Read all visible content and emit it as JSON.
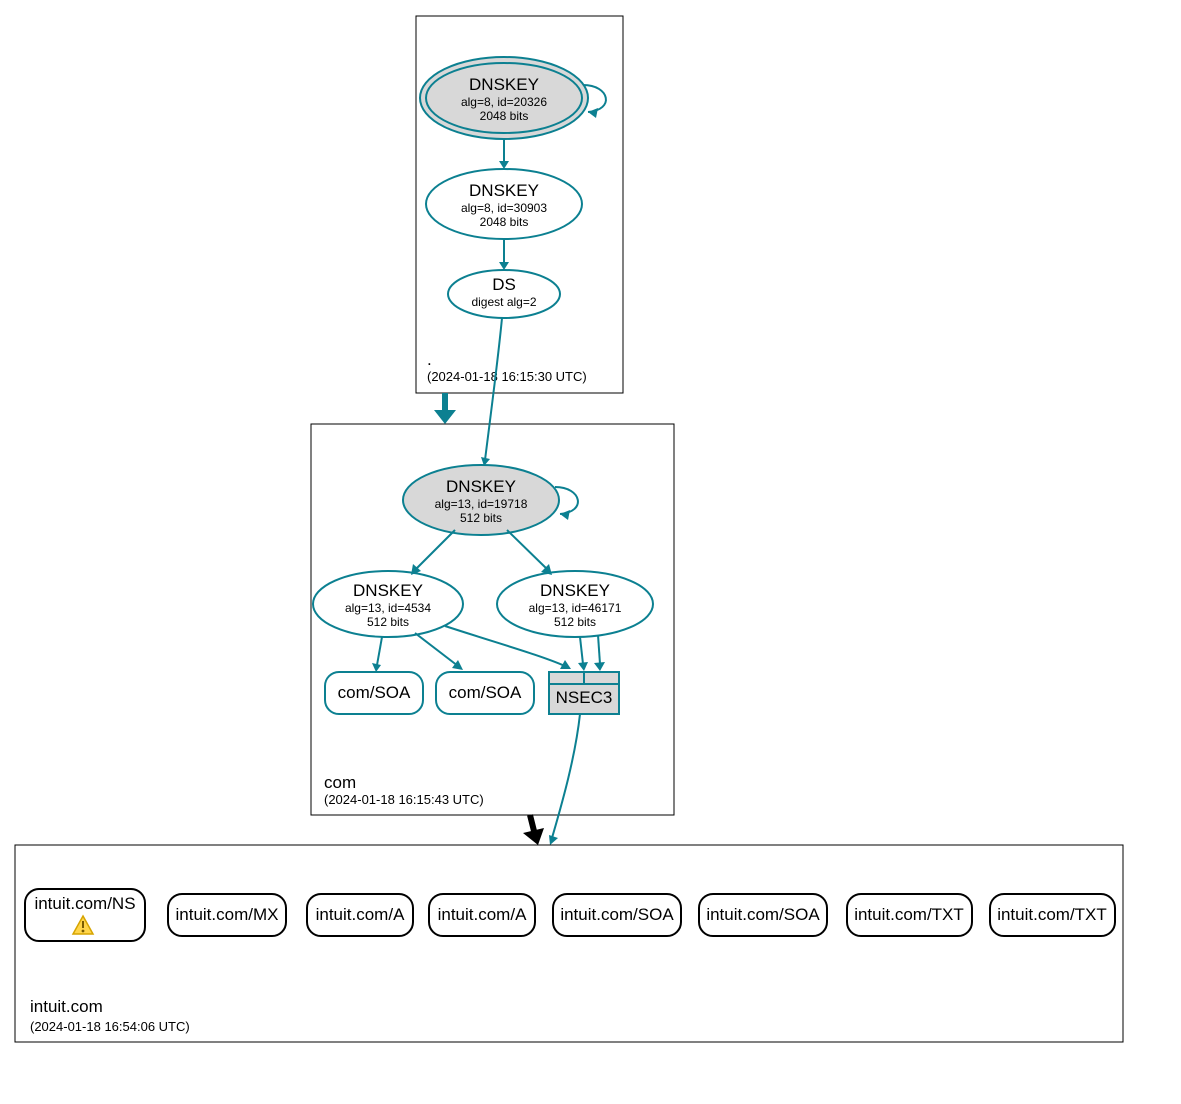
{
  "zones": {
    "root": {
      "label": ".",
      "timestamp": "(2024-01-18 16:15:30 UTC)",
      "ksk": {
        "title": "DNSKEY",
        "alg": "alg=8, id=20326",
        "bits": "2048 bits"
      },
      "zsk": {
        "title": "DNSKEY",
        "alg": "alg=8, id=30903",
        "bits": "2048 bits"
      },
      "ds": {
        "title": "DS",
        "digest": "digest alg=2"
      }
    },
    "com": {
      "label": "com",
      "timestamp": "(2024-01-18 16:15:43 UTC)",
      "ksk": {
        "title": "DNSKEY",
        "alg": "alg=13, id=19718",
        "bits": "512 bits"
      },
      "zsk1": {
        "title": "DNSKEY",
        "alg": "alg=13, id=4534",
        "bits": "512 bits"
      },
      "zsk2": {
        "title": "DNSKEY",
        "alg": "alg=13, id=46171",
        "bits": "512 bits"
      },
      "soa1": "com/SOA",
      "soa2": "com/SOA",
      "nsec3": "NSEC3"
    },
    "intuit": {
      "label": "intuit.com",
      "timestamp": "(2024-01-18 16:54:06 UTC)",
      "records": [
        {
          "text": "intuit.com/NS",
          "warn": true
        },
        {
          "text": "intuit.com/MX",
          "warn": false
        },
        {
          "text": "intuit.com/A",
          "warn": false
        },
        {
          "text": "intuit.com/A",
          "warn": false
        },
        {
          "text": "intuit.com/SOA",
          "warn": false
        },
        {
          "text": "intuit.com/SOA",
          "warn": false
        },
        {
          "text": "intuit.com/TXT",
          "warn": false
        },
        {
          "text": "intuit.com/TXT",
          "warn": false
        }
      ]
    }
  }
}
